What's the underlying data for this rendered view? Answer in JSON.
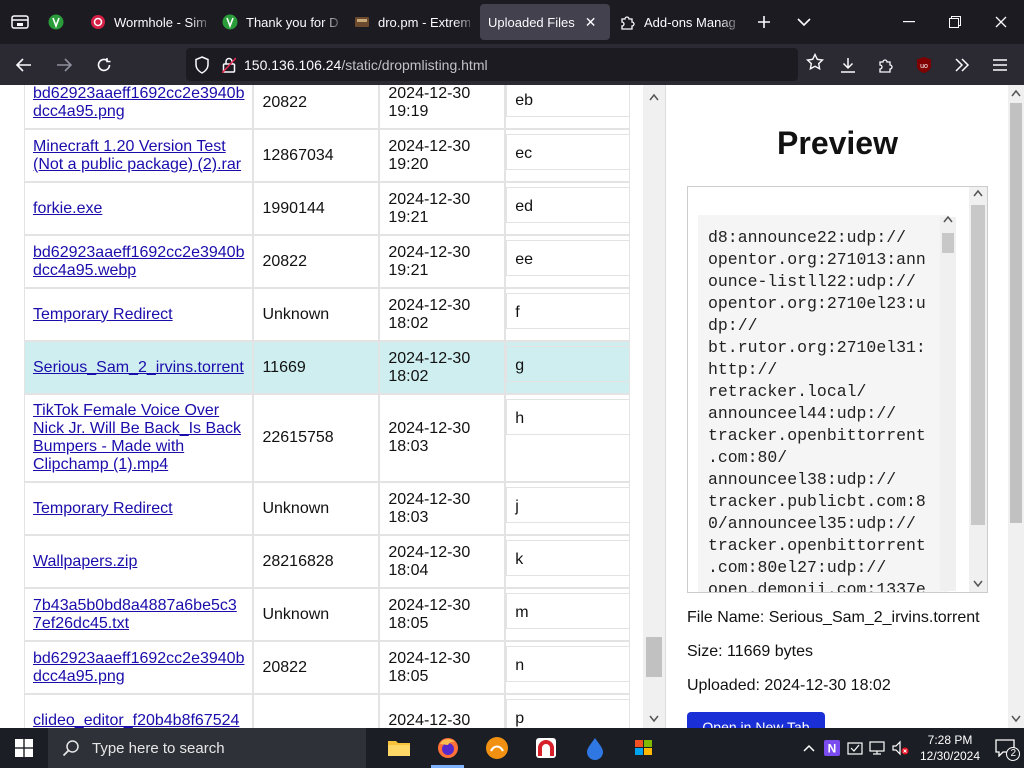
{
  "browser": {
    "tabs": [
      {
        "title": "",
        "icon": "extension-green-icon",
        "active": false
      },
      {
        "title": "Wormhole - Sim",
        "icon": "wormhole-icon",
        "active": false
      },
      {
        "title": "Thank you for Do",
        "icon": "extension-green-icon",
        "active": false
      },
      {
        "title": "dro.pm - Extrem",
        "icon": "drive-icon",
        "active": false
      },
      {
        "title": "Uploaded Files",
        "icon": "",
        "active": true
      },
      {
        "title": "Add-ons Manag",
        "icon": "puzzle-icon",
        "active": false
      }
    ],
    "url_host": "150.136.106.24",
    "url_path": "/static/dropmlisting.html"
  },
  "files": [
    {
      "name": "bd62923aaeff1692cc2e3940b dcc4a95.png",
      "size": "20822",
      "date": "2024-12-30",
      "time": "19:19",
      "key": "eb",
      "selected": false
    },
    {
      "name": "Minecraft 1.20 Version Test (Not a public package) (2).rar",
      "size": "12867034",
      "date": "2024-12-30",
      "time": "19:20",
      "key": "ec",
      "selected": false
    },
    {
      "name": "forkie.exe",
      "size": "1990144",
      "date": "2024-12-30",
      "time": "19:21",
      "key": "ed",
      "selected": false
    },
    {
      "name": "bd62923aaeff1692cc2e3940b dcc4a95.webp",
      "size": "20822",
      "date": "2024-12-30",
      "time": "19:21",
      "key": "ee",
      "selected": false
    },
    {
      "name": "Temporary Redirect",
      "size": "Unknown",
      "date": "2024-12-30",
      "time": "18:02",
      "key": "f",
      "selected": false
    },
    {
      "name": "Serious_Sam_2_irvins.torrent",
      "size": "11669",
      "date": "2024-12-30",
      "time": "18:02",
      "key": "g",
      "selected": true
    },
    {
      "name": "TikTok Female Voice Over Nick Jr. Will Be Back_Is Back Bumpers - Made with Clipchamp (1).mp4",
      "size": "22615758",
      "date": "2024-12-30",
      "time": "18:03",
      "key": "h",
      "selected": false
    },
    {
      "name": "Temporary Redirect",
      "size": "Unknown",
      "date": "2024-12-30",
      "time": "18:03",
      "key": "j",
      "selected": false
    },
    {
      "name": "Wallpapers.zip",
      "size": "28216828",
      "date": "2024-12-30",
      "time": "18:04",
      "key": "k",
      "selected": false
    },
    {
      "name": "7b43a5b0bd8a4887a6be5c3 7ef26dc45.txt",
      "size": "Unknown",
      "date": "2024-12-30",
      "time": "18:05",
      "key": "m",
      "selected": false
    },
    {
      "name": "bd62923aaeff1692cc2e3940b dcc4a95.png",
      "size": "20822",
      "date": "2024-12-30",
      "time": "18:05",
      "key": "n",
      "selected": false
    },
    {
      "name": "clideo_editor_f20b4b8f67524",
      "size": "",
      "date": "2024-12-30",
      "time": "",
      "key": "p",
      "selected": false
    }
  ],
  "preview": {
    "title": "Preview",
    "content": "d8:announce22:udp://\nopentor.org:271013:ann\nounce-listll22:udp://\nopentor.org:2710el23:u\ndp://\nbt.rutor.org:2710el31:\nhttp://\nretracker.local/\nannounceel44:udp://\ntracker.openbittorrent\n.com:80/\nannounceel38:udp://\ntracker.publicbt.com:8\n0/announceel35:udp://\ntracker.openbittorrent\n.com:80el27:udp://\nopen.demonii.com:1337e",
    "file_name_label": "File Name: Serious_Sam_2_irvins.torrent",
    "size_label": "Size: 11669 bytes",
    "uploaded_label": "Uploaded: 2024-12-30 18:02",
    "open_button": "Open in New Tab"
  },
  "taskbar": {
    "search_placeholder": "Type here to search",
    "time": "7:28 PM",
    "date": "12/30/2024",
    "notification_count": "2"
  }
}
